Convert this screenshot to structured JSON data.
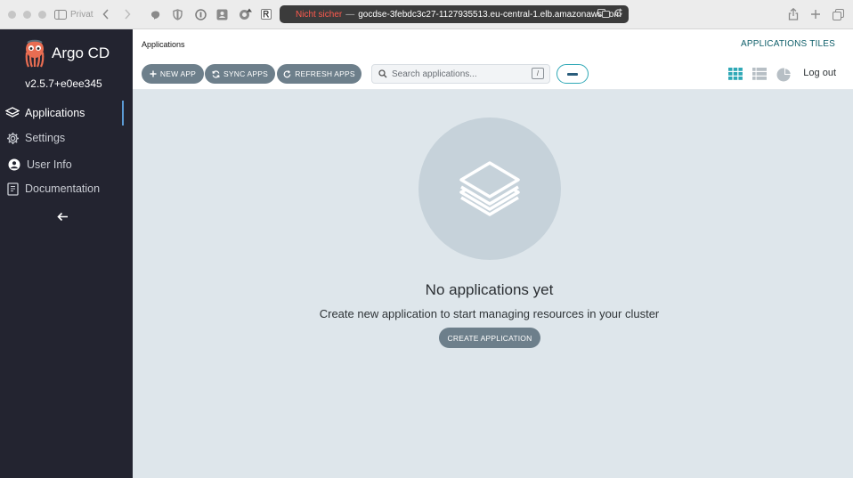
{
  "browser": {
    "private_label": "Privat",
    "address_warning": "Nicht sicher",
    "address_separator": "—",
    "address_host": "gocdse-3febdc3c27-1127935513.eu-central-1.elb.amazonaws.com"
  },
  "sidebar": {
    "app_name": "Argo CD",
    "version": "v2.5.7+e0ee345",
    "items": [
      {
        "label": "Applications",
        "icon": "layers-icon",
        "active": true
      },
      {
        "label": "Settings",
        "icon": "gear-icon",
        "active": false
      },
      {
        "label": "User Info",
        "icon": "user-icon",
        "active": false
      },
      {
        "label": "Documentation",
        "icon": "book-icon",
        "active": false
      }
    ]
  },
  "header": {
    "breadcrumb": "Applications",
    "title": "APPLICATIONS TILES"
  },
  "toolbar": {
    "new_app": "NEW APP",
    "sync_apps": "SYNC APPS",
    "refresh_apps": "REFRESH APPS",
    "search_placeholder": "Search applications...",
    "search_shortcut": "/",
    "logout": "Log out"
  },
  "empty_state": {
    "title": "No applications yet",
    "subtitle": "Create new application to start managing resources in your cluster",
    "create_button": "CREATE APPLICATION"
  },
  "colors": {
    "sidebar_bg": "#232430",
    "accent_teal": "#2ea8b6",
    "button_grey": "#6d7f8b",
    "main_bg": "#dee6eb",
    "active_indicator": "#5b9bd5"
  }
}
